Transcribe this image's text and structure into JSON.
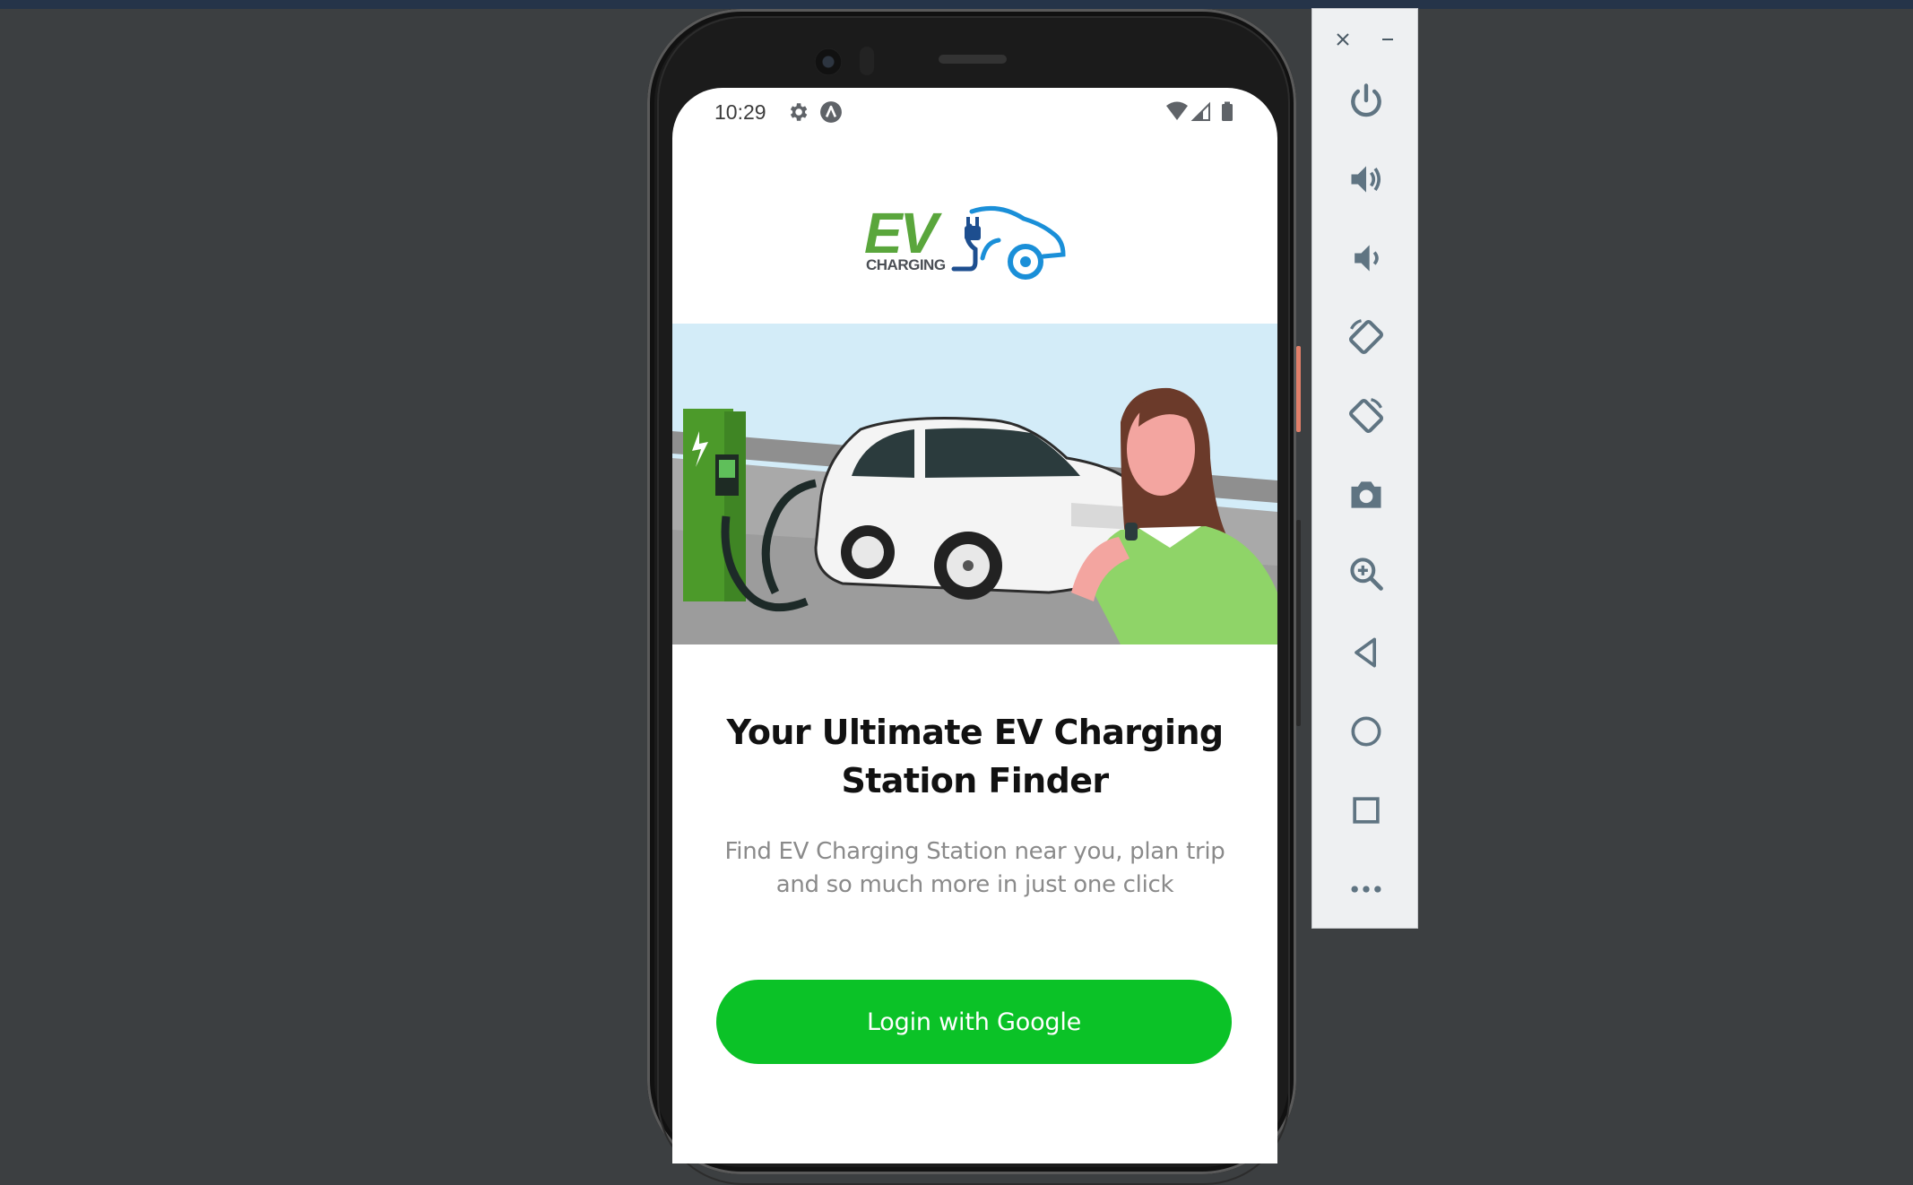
{
  "status_bar": {
    "time": "10:29",
    "icons": [
      "gear-icon",
      "android-a-icon",
      "wifi-icon",
      "signal-icon",
      "battery-icon"
    ]
  },
  "logo": {
    "main_text": "EV",
    "sub_text": "CHARGING",
    "colors": {
      "green": "#5aa63c",
      "blue": "#1a8fd8",
      "dark": "#1d4e8f"
    }
  },
  "hero": {
    "headline": "Your Ultimate EV Charging Station Finder",
    "subtitle": "Find EV Charging Station near you, plan trip and so much more in just one click"
  },
  "login_button": {
    "label": "Login with Google",
    "color": "#0bc227"
  },
  "emulator_toolbar": {
    "buttons": [
      "close-icon",
      "minimize-icon",
      "power-icon",
      "volume-up-icon",
      "volume-down-icon",
      "rotate-left-icon",
      "rotate-right-icon",
      "camera-icon",
      "zoom-icon",
      "back-icon",
      "home-icon",
      "overview-icon",
      "more-icon"
    ]
  },
  "theme": {
    "background": "#3c3f41",
    "accent_green": "#0bc227",
    "toolbar_icon": "#5f7482"
  }
}
